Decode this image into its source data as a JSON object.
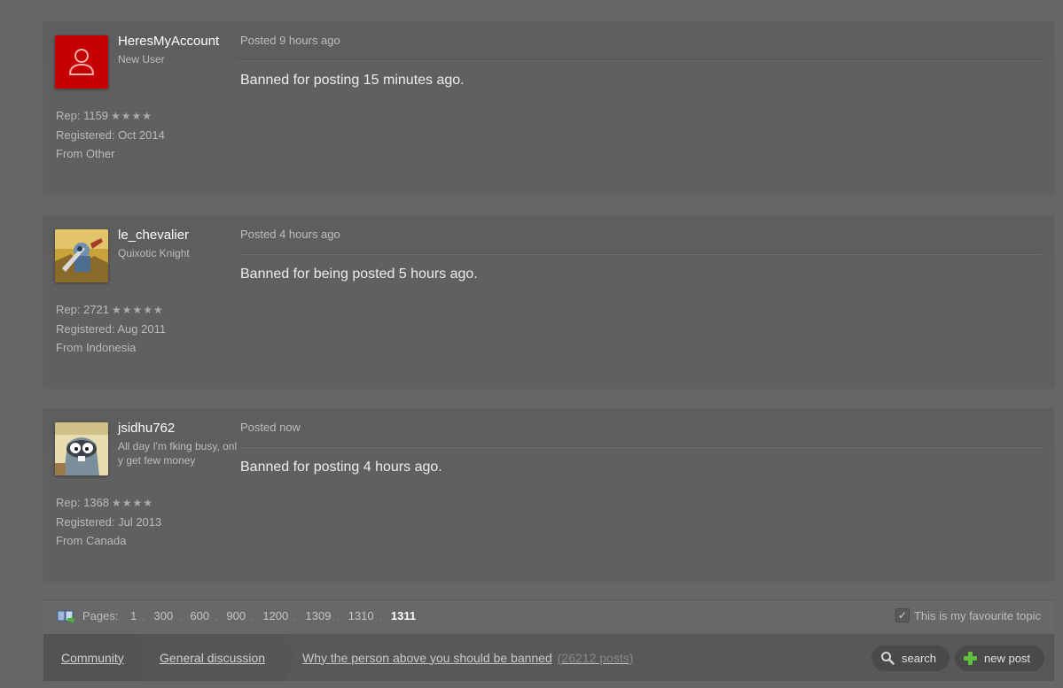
{
  "posts": [
    {
      "username": "HeresMyAccount",
      "user_title": "New User",
      "avatar": "default-user-icon",
      "rep_label": "Rep: 1159",
      "stars": "★★★★",
      "registered": "Registered: Oct 2014",
      "from": "From Other",
      "posted": "Posted 9 hours ago",
      "body": "Banned for posting 15 minutes ago."
    },
    {
      "username": "le_chevalier",
      "user_title": "Quixotic Knight",
      "avatar": "knight-avatar",
      "rep_label": "Rep: 2721",
      "stars": "★★★★★",
      "registered": "Registered: Aug 2011",
      "from": "From Indonesia",
      "posted": "Posted 4 hours ago",
      "body": "Banned for being posted 5 hours ago."
    },
    {
      "username": "jsidhu762",
      "user_title": "All day I'm fking busy, only get few money",
      "avatar": "cartoon-raccoon-avatar",
      "rep_label": "Rep: 1368",
      "stars": "★★★★",
      "registered": "Registered: Jul 2013",
      "from": "From Canada",
      "posted": "Posted now",
      "body": "Banned for posting 4 hours ago."
    }
  ],
  "pager": {
    "label": "Pages:",
    "pages": [
      "1",
      "300",
      "600",
      "900",
      "1200",
      "1309",
      "1310"
    ],
    "current": "1311",
    "favourite_label": "This is my favourite topic"
  },
  "breadcrumb": {
    "community": "Community",
    "forum": "General discussion",
    "topic": "Why the person above you should be banned",
    "count": "(26212 posts)"
  },
  "buttons": {
    "search": "search",
    "new_post": "new post"
  },
  "colors": {
    "background": "#666666",
    "default_avatar": "#c40000",
    "new_post_icon": "#5fc13b"
  }
}
